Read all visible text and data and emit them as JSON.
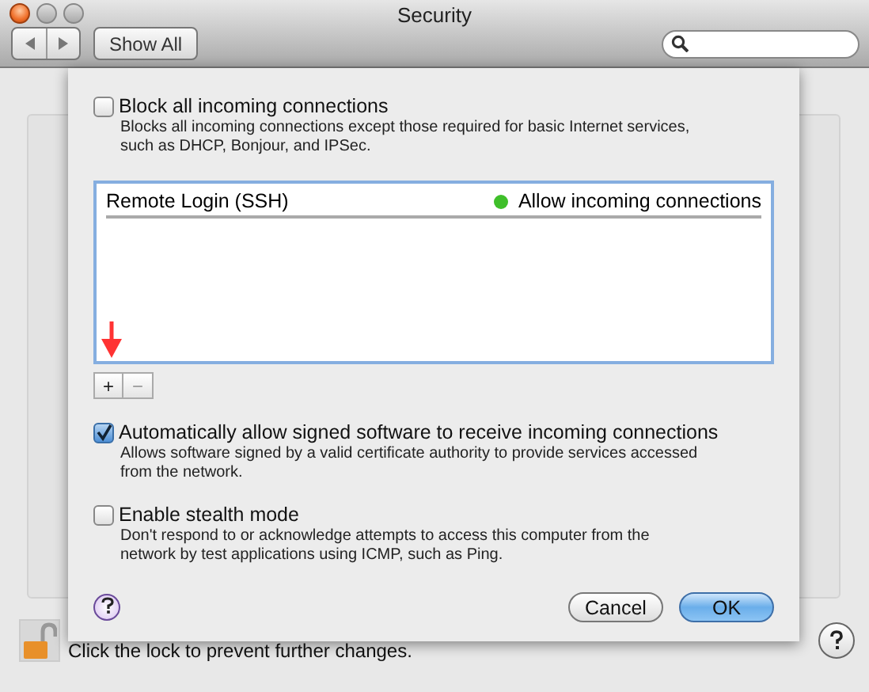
{
  "window": {
    "title": "Security"
  },
  "toolbar": {
    "show_all": "Show All"
  },
  "sheet": {
    "options": [
      {
        "label": "Block all incoming connections",
        "description": "Blocks all incoming connections except those required for basic Internet services, such as DHCP, Bonjour, and IPSec.",
        "checked": false,
        "kind": "plain"
      },
      {
        "label": "Automatically allow signed software to receive incoming connections",
        "description": "Allows software signed by a valid certificate authority to provide services accessed from the network.",
        "checked": true,
        "kind": "plain"
      },
      {
        "label": "Enable stealth mode",
        "description": "Don't respond to or acknowledge attempts to access this computer from the network by test applications using ICMP, such as Ping.",
        "checked": false,
        "kind": "plain"
      }
    ],
    "services": [
      {
        "name": "Remote Login (SSH)",
        "status": "Allow incoming connections",
        "color": "#3fbf2a"
      }
    ],
    "add": "+",
    "remove": "−",
    "buttons": [
      {
        "label": "Cancel",
        "default": false
      },
      {
        "label": "OK",
        "default": true
      }
    ]
  },
  "lock": {
    "text": "Click the lock to prevent further changes.",
    "locked": false
  }
}
